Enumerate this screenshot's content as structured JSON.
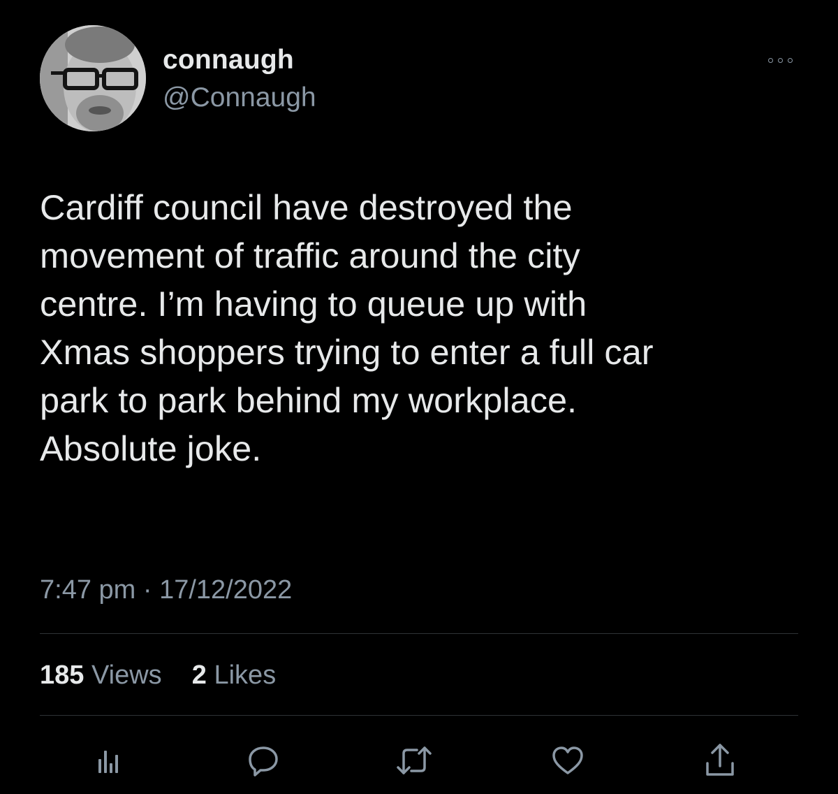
{
  "author": {
    "display_name": "connaugh",
    "handle": "@Connaugh"
  },
  "tweet": {
    "text": "Cardiff council have destroyed the\nmovement of traffic around the city\ncentre. I’m having to queue up with\nXmas shoppers trying to enter a full car\npark to park behind my workplace.\nAbsolute joke.",
    "time": "7:47 pm",
    "separator": "·",
    "date": "17/12/2022"
  },
  "stats": {
    "views_count": "185",
    "views_label": "Views",
    "likes_count": "2",
    "likes_label": "Likes"
  },
  "actions": {
    "icons": [
      "analytics-icon",
      "reply-icon",
      "retweet-icon",
      "like-icon",
      "share-icon"
    ]
  },
  "colors": {
    "background": "#000000",
    "primary_text": "#e7e9ea",
    "secondary_text": "#8b98a5",
    "divider": "#2f3336"
  }
}
